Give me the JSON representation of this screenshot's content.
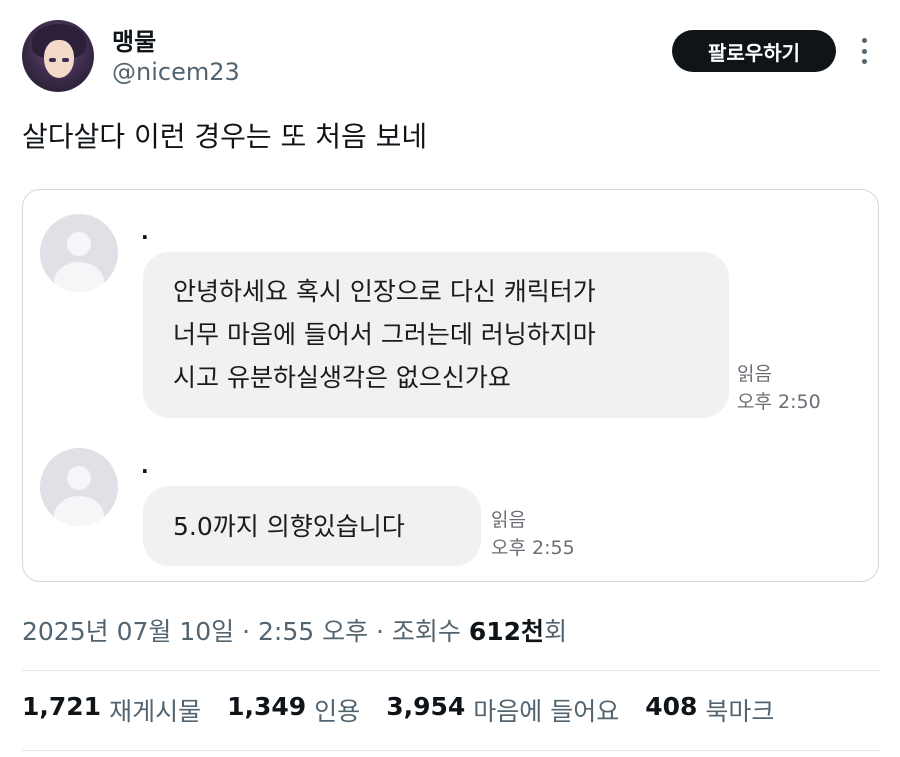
{
  "user": {
    "display_name": "맹물",
    "handle": "@nicem23"
  },
  "follow_button": {
    "label": "팔로우하기"
  },
  "tweet": {
    "text": "살다살다 이런 경우는 또 처음 보네"
  },
  "chat": {
    "messages": [
      {
        "sender": ".",
        "lines": [
          "안녕하세요 혹시 인장으로 다신 캐릭터가",
          "너무 마음에 들어서 그러는데 러닝하지마",
          "시고 유분하실생각은 없으신가요"
        ],
        "read_status": "읽음",
        "time": "오후 2:50"
      },
      {
        "sender": ".",
        "lines": [
          "5.0까지 의향있습니다"
        ],
        "read_status": "읽음",
        "time": "오후 2:55"
      }
    ]
  },
  "meta": {
    "date": "2025년 07월 10일",
    "sep1": " · ",
    "time": "2:55 오후",
    "sep2": " · ",
    "views_label": "조회수 ",
    "views_count": "612천",
    "views_suffix": "회"
  },
  "stats": {
    "retweets": {
      "count": "1,721",
      "label": "재게시물"
    },
    "quotes": {
      "count": "1,349",
      "label": "인용"
    },
    "likes": {
      "count": "3,954",
      "label": "마음에 들어요"
    },
    "bookmarks": {
      "count": "408",
      "label": "북마크"
    }
  },
  "colors": {
    "text": "#0f1419",
    "secondary": "#536471",
    "button_bg": "#0f1419",
    "bubble_bg": "#f0f1f3",
    "border": "#cfd9de"
  }
}
